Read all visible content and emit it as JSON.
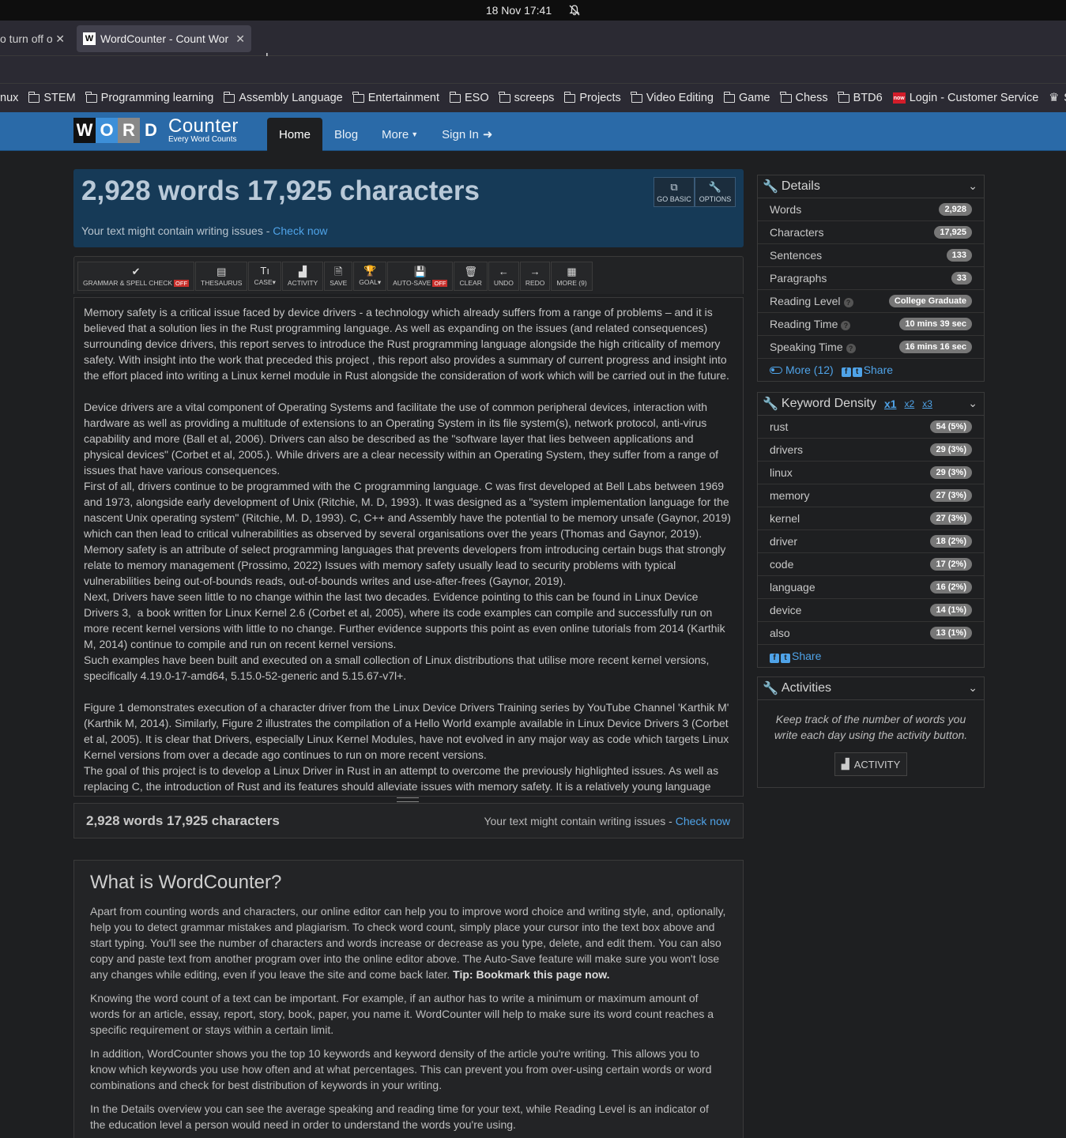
{
  "os": {
    "datetime": "18 Nov  17:41"
  },
  "browser": {
    "tabs": [
      {
        "label": "o turn off op"
      },
      {
        "label": "WordCounter - Count Wor",
        "favicon": "W"
      }
    ],
    "bookmarks": [
      "nux",
      "STEM",
      "Programming learning",
      "Assembly Language",
      "Entertainment",
      "ESO",
      "screeps",
      "Projects",
      "Video Editing",
      "Game",
      "Chess",
      "BTD6",
      "Login - Customer Service",
      "S"
    ]
  },
  "site": {
    "logo_letters": [
      "W",
      "O",
      "R",
      "D"
    ],
    "logo_counter": "Counter",
    "logo_tagline": "Every Word Counts",
    "nav": {
      "home": "Home",
      "blog": "Blog",
      "more": "More",
      "signin": "Sign In"
    }
  },
  "header": {
    "title": "2,928 words 17,925 characters",
    "issues_text": "Your text might contain writing issues - ",
    "check_now": "Check now",
    "go_basic": "GO BASIC",
    "options": "OPTIONS"
  },
  "toolbar": {
    "grammar": "GRAMMAR & SPELL CHECK",
    "grammar_state": "OFF",
    "thesaurus": "THESAURUS",
    "case": "CASE",
    "activity": "ACTIVITY",
    "save": "SAVE",
    "goal": "GOAL",
    "autosave": "AUTO-SAVE",
    "autosave_state": "OFF",
    "clear": "CLEAR",
    "undo": "UNDO",
    "redo": "REDO",
    "more": "MORE (9)"
  },
  "editor": {
    "paragraphs": [
      "Memory safety is a critical issue faced by device drivers - a technology which already suffers from a range of problems – and it is believed that a solution lies in the Rust programming language. As well as expanding on the issues (and related consequences) surrounding device drivers, this report serves to introduce the Rust programming language alongside the high criticality of memory safety. With insight into the work that preceded this project , this report also provides a summary of current progress and insight into the effort placed into writing a Linux kernel module in Rust alongside the consideration of work which will be carried out in the future.\n\nDevice drivers are a vital component of Operating Systems and facilitate the use of common peripheral devices, interaction with hardware as well as providing a multitude of extensions to an Operating System in its file system(s), network protocol, anti-virus capability and more (Ball et al, 2006). Drivers can also be described as the \"software layer that lies between applications and physical devices\" (Corbet et al, 2005.). While drivers are a clear necessity within an Operating System, they suffer from a range of issues that have various consequences.\nFirst of all, drivers continue to be programmed with the C programming language. C was first developed at Bell Labs between 1969 and 1973, alongside early development of Unix (Ritchie, M. D, 1993). It was designed as a \"system implementation language for the nascent Unix operating system\" (Ritchie, M. D, 1993). C, C++ and Assembly have the potential to be memory unsafe (Gaynor, 2019) which can then lead to critical vulnerabilities as observed by several organisations over the years (Thomas and Gaynor, 2019).\nMemory safety is an attribute of select programming languages that prevents developers from introducing certain bugs that strongly relate to memory management (Prossimo, 2022) Issues with memory safety usually lead to security problems with typical vulnerabilities being out-of-bounds reads, out-of-bounds writes and use-after-frees (Gaynor, 2019).\nNext, Drivers have seen little to no change within the last two decades. Evidence pointing to this can be found in Linux Device Drivers 3,  a book written for Linux Kernel 2.6 (Corbet et al, 2005), where its code examples can compile and successfully run on more recent kernel versions with little to no change. Further evidence supports this point as even online tutorials from 2014 (Karthik M, 2014) continue to compile and run on recent kernel versions.\nSuch examples have been built and executed on a small collection of Linux distributions that utilise more recent kernel versions, specifically 4.19.0-17-amd64, 5.15.0-52-generic and 5.15.67-v7l+.\n\nFigure 1 demonstrates execution of a character driver from the Linux Device Drivers Training series by YouTube Channel 'Karthik M' (Karthik M, 2014). Similarly, Figure 2 illustrates the compilation of a Hello World example available in Linux Device Drivers 3 (Corbet et al, 2005). It is clear that Drivers, especially Linux Kernel Modules, have not evolved in any major way as code which targets Linux Kernel versions from over a decade ago continues to run on more recent versions.\nThe goal of this project is to develop a Linux Driver in Rust in an attempt to overcome the previously highlighted issues. As well as replacing C, the introduction of Rust and its features should alleviate issues with memory safety. It is a relatively young language"
    ]
  },
  "footer": {
    "count": "2,928 words 17,925 characters",
    "issues_text": "Your text might contain writing issues - ",
    "check_now": "Check now"
  },
  "about": {
    "title": "What is WordCounter?",
    "p1": "Apart from counting words and characters, our online editor can help you to improve word choice and writing style, and, optionally, help you to detect grammar mistakes and plagiarism. To check word count, simply place your cursor into the text box above and start typing. You'll see the number of characters and words increase or decrease as you type, delete, and edit them. You can also copy and paste text from another program over into the online editor above. The Auto-Save feature will make sure you won't lose any changes while editing, even if you leave the site and come back later. ",
    "p1_tip": "Tip: Bookmark this page now.",
    "p2": "Knowing the word count of a text can be important. For example, if an author has to write a minimum or maximum amount of words for an article, essay, report, story, book, paper, you name it. WordCounter will help to make sure its word count reaches a specific requirement or stays within a certain limit.",
    "p3": "In addition, WordCounter shows you the top 10 keywords and keyword density of the article you're writing. This allows you to know which keywords you use how often and at what percentages. This can prevent you from over-using certain words or word combinations and check for best distribution of keywords in your writing.",
    "p4": "In the Details overview you can see the average speaking and reading time for your text, while Reading Level is an indicator of the education level a person would need in order to understand the words you're using."
  },
  "details": {
    "title": "Details",
    "rows": [
      {
        "label": "Words",
        "value": "2,928"
      },
      {
        "label": "Characters",
        "value": "17,925"
      },
      {
        "label": "Sentences",
        "value": "133"
      },
      {
        "label": "Paragraphs",
        "value": "33"
      },
      {
        "label": "Reading Level",
        "value": "College Graduate"
      },
      {
        "label": "Reading Time",
        "value": "10 mins 39 sec"
      },
      {
        "label": "Speaking Time",
        "value": "16 mins 16 sec"
      }
    ],
    "more": "More (12)",
    "share": "Share"
  },
  "keywords": {
    "title": "Keyword Density",
    "x1": "x1",
    "x2": "x2",
    "x3": "x3",
    "rows": [
      {
        "word": "rust",
        "value": "54 (5%)"
      },
      {
        "word": "drivers",
        "value": "29 (3%)"
      },
      {
        "word": "linux",
        "value": "29 (3%)"
      },
      {
        "word": "memory",
        "value": "27 (3%)"
      },
      {
        "word": "kernel",
        "value": "27 (3%)"
      },
      {
        "word": "driver",
        "value": "18 (2%)"
      },
      {
        "word": "code",
        "value": "17 (2%)"
      },
      {
        "word": "language",
        "value": "16 (2%)"
      },
      {
        "word": "device",
        "value": "14 (1%)"
      },
      {
        "word": "also",
        "value": "13 (1%)"
      }
    ],
    "share": "Share"
  },
  "activities": {
    "title": "Activities",
    "text": "Keep track of the number of words you write each day using the activity button.",
    "button": "ACTIVITY"
  }
}
